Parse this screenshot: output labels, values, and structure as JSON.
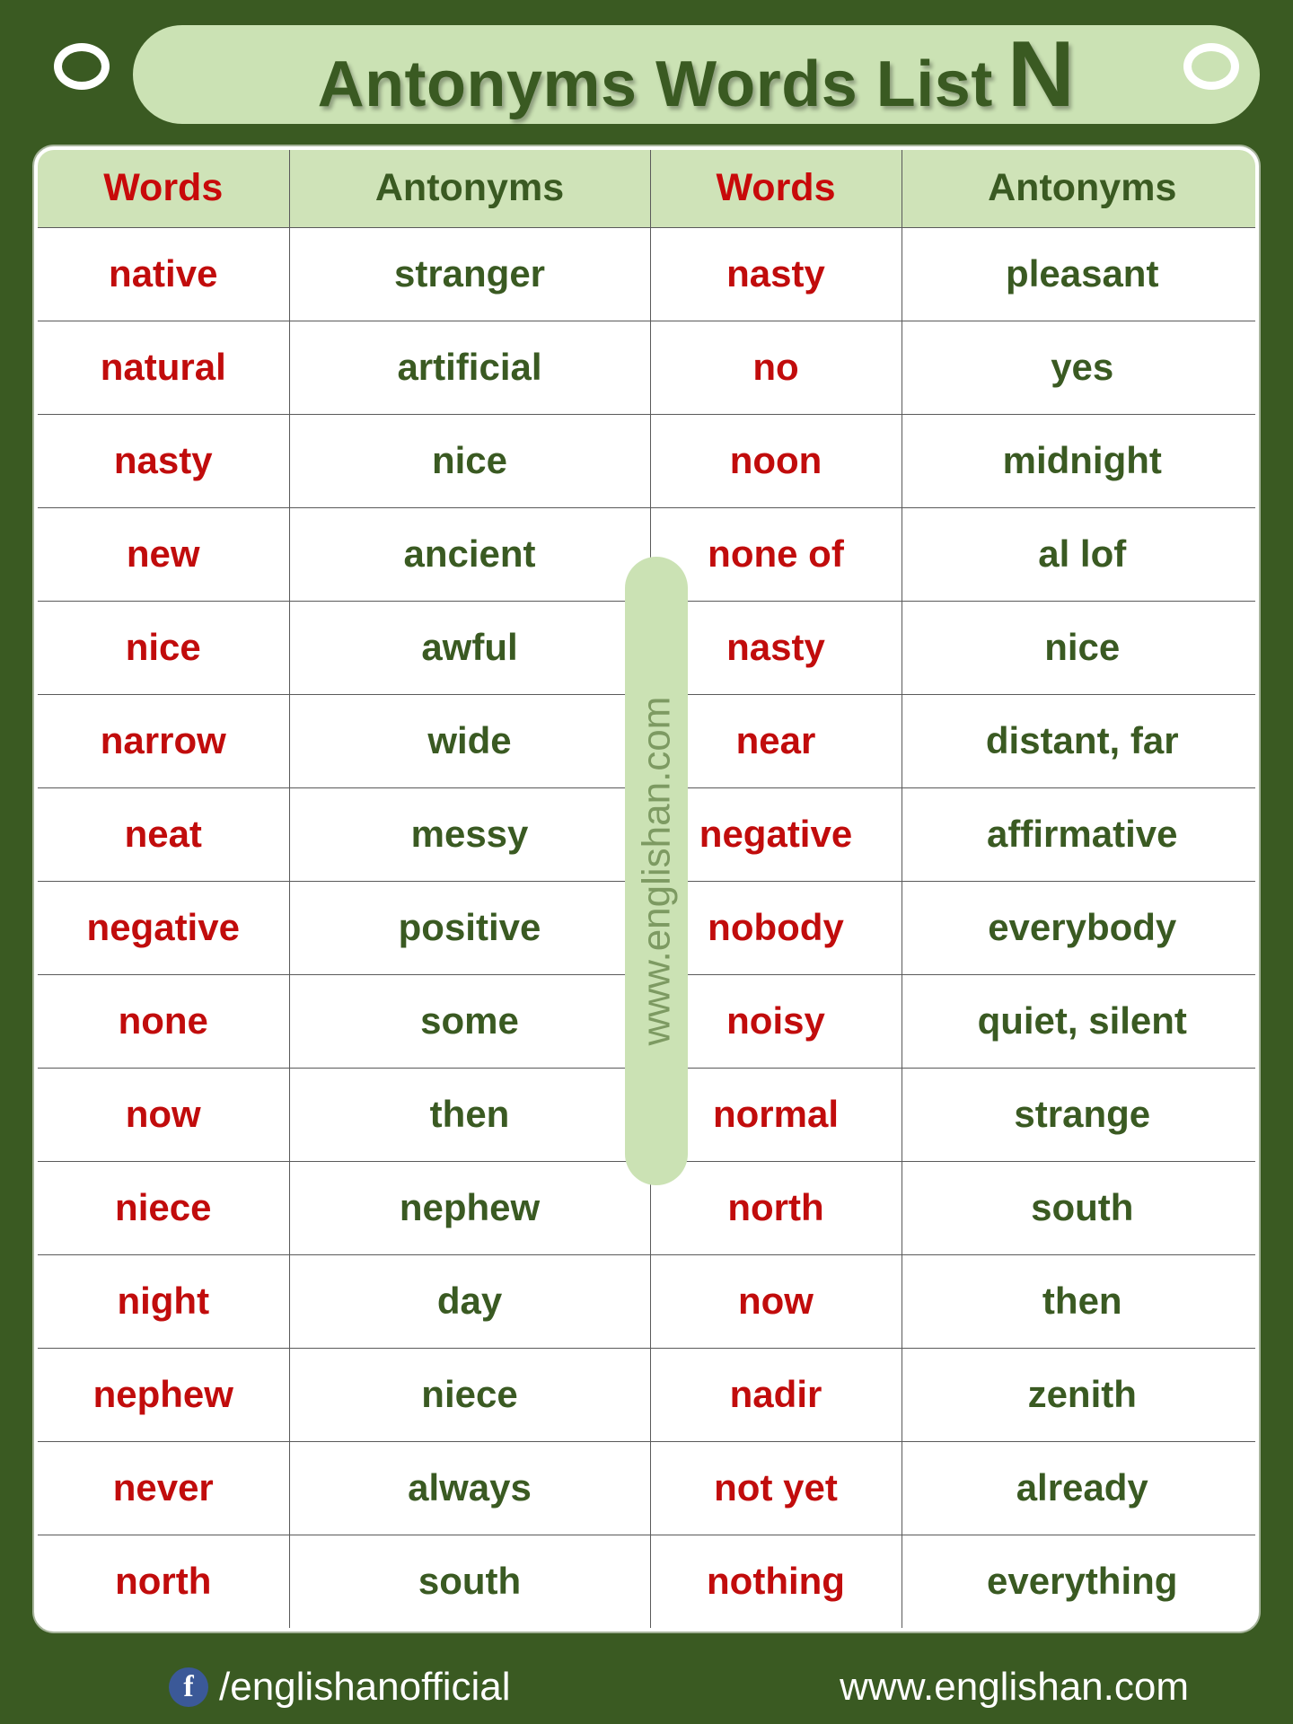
{
  "header": {
    "title": "Antonyms Words  List",
    "letter": "N",
    "punch_hole_left": "punch-hole-left",
    "punch_hole_right": "punch-hole-right"
  },
  "table": {
    "headers": [
      "Words",
      "Antonyms",
      "Words",
      "Antonyms"
    ],
    "rows": [
      {
        "word_l": "native",
        "ant_l": "stranger",
        "word_r": "nasty",
        "ant_r": "pleasant"
      },
      {
        "word_l": "natural",
        "ant_l": "artificial",
        "word_r": "no",
        "ant_r": "yes"
      },
      {
        "word_l": "nasty",
        "ant_l": "nice",
        "word_r": "noon",
        "ant_r": "midnight"
      },
      {
        "word_l": "new",
        "ant_l": "ancient",
        "word_r": "none of",
        "ant_r": "al lof"
      },
      {
        "word_l": "nice",
        "ant_l": "awful",
        "word_r": "nasty",
        "ant_r": "nice"
      },
      {
        "word_l": "narrow",
        "ant_l": "wide",
        "word_r": "near",
        "ant_r": "distant, far"
      },
      {
        "word_l": "neat",
        "ant_l": "messy",
        "word_r": "negative",
        "ant_r": "affirmative"
      },
      {
        "word_l": "negative",
        "ant_l": "positive",
        "word_r": "nobody",
        "ant_r": "everybody"
      },
      {
        "word_l": "none",
        "ant_l": "some",
        "word_r": "noisy",
        "ant_r": "quiet, silent"
      },
      {
        "word_l": "now",
        "ant_l": "then",
        "word_r": "normal",
        "ant_r": "strange"
      },
      {
        "word_l": "niece",
        "ant_l": "nephew",
        "word_r": "north",
        "ant_r": "south"
      },
      {
        "word_l": "night",
        "ant_l": "day",
        "word_r": "now",
        "ant_r": "then"
      },
      {
        "word_l": "nephew",
        "ant_l": "niece",
        "word_r": "nadir",
        "ant_r": "zenith"
      },
      {
        "word_l": "never",
        "ant_l": "always",
        "word_r": "not yet",
        "ant_r": "already"
      },
      {
        "word_l": "north",
        "ant_l": "south",
        "word_r": "nothing",
        "ant_r": "everything"
      }
    ]
  },
  "watermark": {
    "text": "www.englishan.com"
  },
  "footer": {
    "facebook_glyph": "f",
    "facebook_handle": "/englishanofficial",
    "website": "www.englishan.com"
  },
  "colors": {
    "background_green": "#3a5a22",
    "banner_light_green": "#cbe2b4",
    "header_cell_green": "#cfe3b8",
    "word_red": "#c10c0c",
    "antonym_green": "#3a5a22",
    "watermark_text": "#7d9a62",
    "facebook_blue": "#3b5998",
    "white": "#ffffff"
  }
}
